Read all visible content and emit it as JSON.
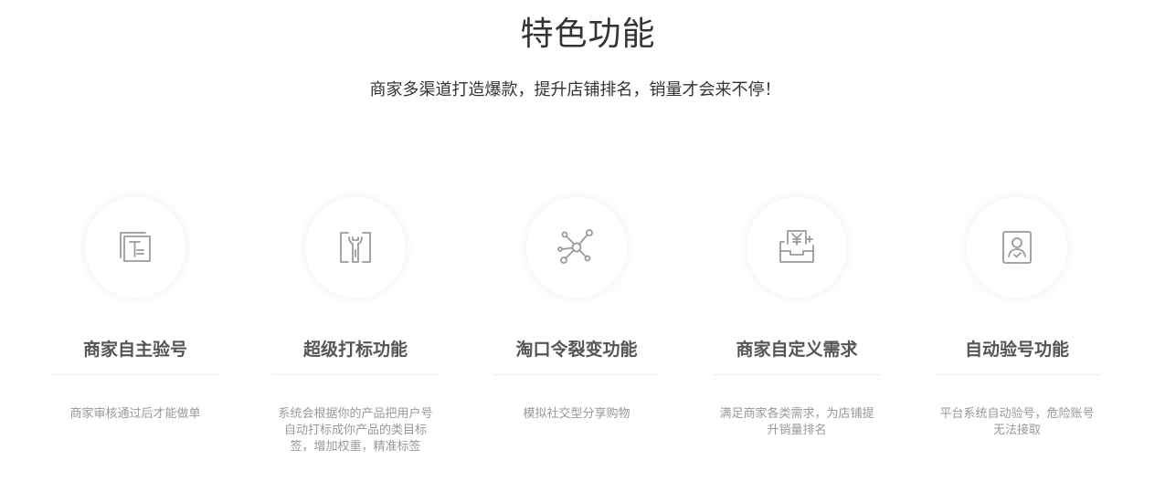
{
  "header": {
    "title": "特色功能",
    "subtitle": "商家多渠道打造爆款，提升店铺排名，销量才会来不停！"
  },
  "features": [
    {
      "icon": "document-icon",
      "title": "商家自主验号",
      "desc": "商家审核通过后才能做单"
    },
    {
      "icon": "tools-icon",
      "title": "超级打标功能",
      "desc": "系统会根据你的产品把用户号自动打标成你产品的类目标签，增加权重，精准标签"
    },
    {
      "icon": "network-icon",
      "title": "淘口令裂变功能",
      "desc": "模拟社交型分享购物"
    },
    {
      "icon": "yen-inbox-icon",
      "title": "商家自定义需求",
      "desc": "满足商家各类需求，为店铺提升销量排名"
    },
    {
      "icon": "user-verify-icon",
      "title": "自动验号功能",
      "desc": "平台系统自动验号，危险账号无法接取"
    }
  ],
  "colors": {
    "icon_stroke": "#9a9a9a",
    "title": "#555555",
    "desc": "#999999"
  }
}
